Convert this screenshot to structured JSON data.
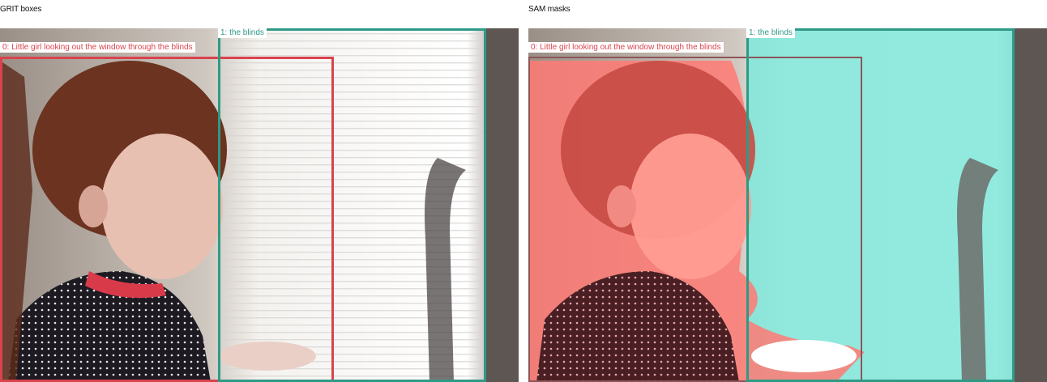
{
  "panels": {
    "left": {
      "title": "GRIT boxes"
    },
    "right": {
      "title": "SAM masks"
    }
  },
  "detections": [
    {
      "label": "0: Little girl looking out the window through the blinds",
      "color": "#d9434e"
    },
    {
      "label": "1: the blinds",
      "color": "#2e9a86"
    }
  ],
  "colors": {
    "girl_mask": "#ff6b6b",
    "blinds_mask": "#7fe6d9"
  }
}
